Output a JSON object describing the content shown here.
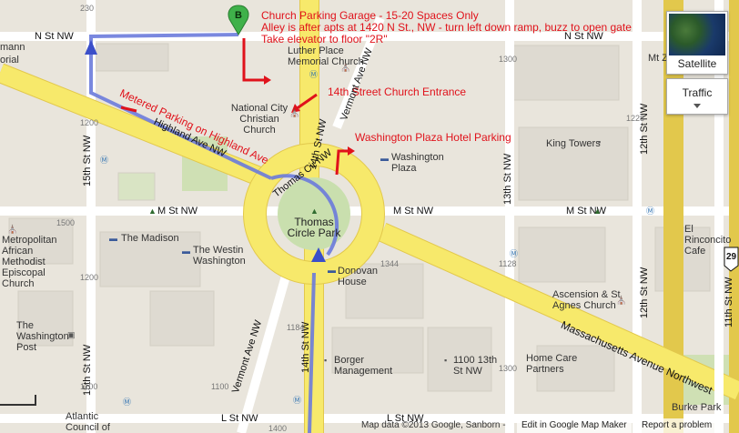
{
  "annotations": {
    "garage_title": "Church Parking Garage - 15-20 Spaces Only",
    "garage_line2": "Alley is after apts at 1420 N St., NW - turn left down ramp, buzz to open gate",
    "garage_line3": "Take elevator to floor \"2R\"",
    "church_entrance": "14th Street Church Entrance",
    "hotel_parking": "Washington Plaza Hotel Parking",
    "metered_parking": "Metered Parking on Highland Ave"
  },
  "marker": {
    "letter": "B"
  },
  "streets": {
    "n_st_left": "N St NW",
    "n_st_right": "N St NW",
    "m_st_left": "M St NW",
    "m_st_mid": "M St NW",
    "m_st_right": "M St NW",
    "l_st_left": "L St NW",
    "l_st_right": "L St NW",
    "thomas_cir": "Thomas Cir NW",
    "highland": "Highland Ave NW",
    "mass_ave": "Massachusetts Avenue Northwest",
    "vermont_top": "Vermont Ave NW",
    "vermont_bottom": "Vermont Ave NW",
    "fifteenth_top": "15th St NW",
    "fifteenth_bottom": "15th St NW",
    "fourteenth_top": "14th St NW",
    "fourteenth_bottom": "14th St NW",
    "thirteenth": "13th St NW",
    "twelfth_top": "12th St NW",
    "twelfth_bottom": "12th St NW",
    "eleventh": "11th St NW"
  },
  "places": {
    "luther_place": "Luther Place Memorial Church",
    "national_city": "National City Christian Church",
    "washington_plaza": "Washington Plaza",
    "king_towers": "King Towers",
    "thomas_circle_park": "Thomas Circle Park",
    "metropolitan": "Metropolitan African Methodist Episcopal Church",
    "the_madison": "The Madison",
    "the_westin": "The Westin Washington",
    "donovan": "Donovan House",
    "washington_post": "The Washington Post",
    "borger": "Borger Management",
    "thirteenth_bldg": "1100 13th St NW",
    "ascension": "Ascension & St Agnes Church",
    "home_care": "Home Care Partners",
    "el_rinconcito": "El Rinconcito Cafe",
    "burke_park": "Burke Park",
    "mt_z": "Mt Z",
    "atlantic": "Atlantic Council of Us",
    "manna_partial": "mann",
    "orial_partial": "orial"
  },
  "numbers": [
    "230",
    "1500",
    "1200",
    "1200",
    "1100",
    "1300",
    "1344",
    "1128",
    "1184",
    "1228",
    "1400",
    "1100",
    "1300"
  ],
  "route_shield": "29",
  "controls": {
    "satellite": "Satellite",
    "traffic": "Traffic"
  },
  "footer": {
    "map_data": "Map data ©2013 Google, Sanborn -",
    "edit": "Edit in Google Map Maker",
    "report": "Report a problem"
  },
  "colors": {
    "road_yellow": "#f7e96b",
    "road_stroke": "#e2c84c",
    "route_blue": "#6b7bdc",
    "annotation_red": "#e0121b",
    "marker_green": "#3fb14a"
  }
}
